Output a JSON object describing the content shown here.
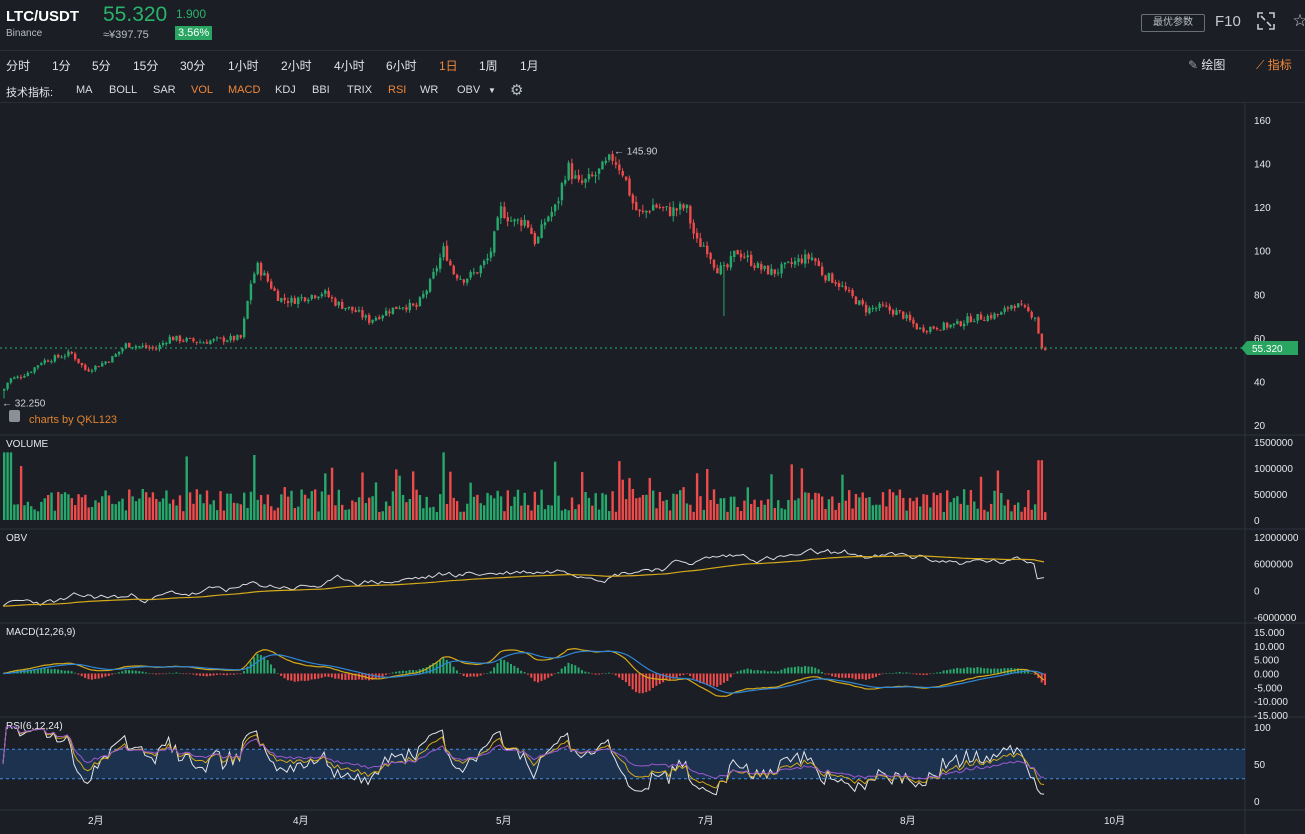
{
  "header": {
    "symbol": "LTC/USDT",
    "exchange": "Binance",
    "price": "55.320",
    "change": "1.900",
    "cny_price": "≈¥397.75",
    "change_pct": "3.56%",
    "best_params_label": "最优参数",
    "f10_label": "F10",
    "fullscreen_icon": "fullscreen-icon",
    "favorite_icon": "star-icon"
  },
  "timeframes": [
    "分时",
    "1分",
    "5分",
    "15分",
    "30分",
    "1小时",
    "2小时",
    "4小时",
    "6小时",
    "1日",
    "1周",
    "1月"
  ],
  "active_timeframe": "1日",
  "tools": {
    "draw_label": "绘图",
    "indicator_label": "指标"
  },
  "indicators": {
    "label": "技术指标:",
    "items": [
      "MA",
      "BOLL",
      "SAR",
      "VOL",
      "MACD",
      "KDJ",
      "BBI",
      "TRIX",
      "RSI",
      "WR",
      "OBV"
    ],
    "active": [
      "VOL",
      "MACD",
      "RSI"
    ],
    "settings_icon": "gear-icon"
  },
  "colors": {
    "up": "#26a96c",
    "down": "#ef4b4b",
    "accent": "#f0883a",
    "background": "#1b1e25"
  },
  "chart_data": [
    {
      "type": "candlestick",
      "name": "LTC/USDT 1日",
      "y_ticks": [
        "160",
        "140",
        "120",
        "100",
        "80",
        "60",
        "40",
        "20"
      ],
      "ylim": [
        20,
        160
      ],
      "x_ticks": [
        "2月",
        "4月",
        "5月",
        "7月",
        "8月",
        "10月"
      ],
      "high_marker": "145.90",
      "low_marker": "32.250",
      "last_price": "55.320",
      "watermark": "charts by QKL123",
      "close_path": [
        [
          0,
          34
        ],
        [
          8,
          41
        ],
        [
          18,
          42
        ],
        [
          30,
          45
        ],
        [
          40,
          49
        ],
        [
          55,
          51
        ],
        [
          70,
          53
        ],
        [
          85,
          45
        ],
        [
          100,
          48
        ],
        [
          112,
          51
        ],
        [
          125,
          57
        ],
        [
          140,
          56
        ],
        [
          155,
          55
        ],
        [
          168,
          60
        ],
        [
          185,
          59
        ],
        [
          200,
          58
        ],
        [
          215,
          59
        ],
        [
          240,
          60
        ],
        [
          250,
          86
        ],
        [
          256,
          93
        ],
        [
          264,
          88
        ],
        [
          278,
          78
        ],
        [
          290,
          77
        ],
        [
          305,
          79
        ],
        [
          322,
          81
        ],
        [
          335,
          76
        ],
        [
          355,
          72
        ],
        [
          368,
          68
        ],
        [
          385,
          72
        ],
        [
          400,
          75
        ],
        [
          415,
          74
        ],
        [
          428,
          84
        ],
        [
          443,
          101
        ],
        [
          452,
          90
        ],
        [
          462,
          87
        ],
        [
          475,
          90
        ],
        [
          488,
          97
        ],
        [
          500,
          119
        ],
        [
          512,
          113
        ],
        [
          525,
          114
        ],
        [
          535,
          103
        ],
        [
          545,
          115
        ],
        [
          555,
          120
        ],
        [
          566,
          139
        ],
        [
          578,
          130
        ],
        [
          590,
          133
        ],
        [
          600,
          137
        ],
        [
          612,
          143
        ],
        [
          622,
          136
        ],
        [
          633,
          120
        ],
        [
          640,
          116
        ],
        [
          652,
          121
        ],
        [
          668,
          118
        ],
        [
          685,
          120
        ],
        [
          695,
          104
        ],
        [
          705,
          102
        ],
        [
          715,
          92
        ],
        [
          725,
          91
        ],
        [
          735,
          100
        ],
        [
          745,
          97
        ],
        [
          758,
          92
        ],
        [
          772,
          90
        ],
        [
          787,
          93
        ],
        [
          800,
          96
        ],
        [
          812,
          97
        ],
        [
          822,
          89
        ],
        [
          835,
          86
        ],
        [
          850,
          79
        ],
        [
          865,
          73
        ],
        [
          880,
          74
        ],
        [
          900,
          71
        ],
        [
          918,
          64
        ],
        [
          935,
          65
        ],
        [
          955,
          66
        ],
        [
          970,
          69
        ],
        [
          990,
          70
        ],
        [
          1000,
          71
        ],
        [
          1012,
          76
        ],
        [
          1022,
          73
        ],
        [
          1034,
          70
        ],
        [
          1040,
          56
        ],
        [
          1046,
          53
        ]
      ]
    },
    {
      "type": "bar",
      "name": "VOLUME",
      "y_ticks": [
        "1500000",
        "1000000",
        "500000",
        "0"
      ],
      "ylim": [
        0,
        1500000
      ]
    },
    {
      "type": "line",
      "name": "OBV",
      "y_ticks": [
        "12000000",
        "6000000",
        "0",
        "-6000000"
      ],
      "ylim": [
        -6000000,
        12000000
      ]
    },
    {
      "type": "line",
      "name": "MACD(12,26,9)",
      "y_ticks": [
        "15.000",
        "10.000",
        "5.000",
        "0.000",
        "-5.000",
        "-10.000",
        "-15.000"
      ],
      "ylim": [
        -15,
        15
      ]
    },
    {
      "type": "line",
      "name": "RSI(6,12,24)",
      "y_ticks": [
        "100",
        "50",
        "0"
      ],
      "ylim": [
        0,
        100
      ],
      "band": [
        30,
        70
      ]
    }
  ]
}
